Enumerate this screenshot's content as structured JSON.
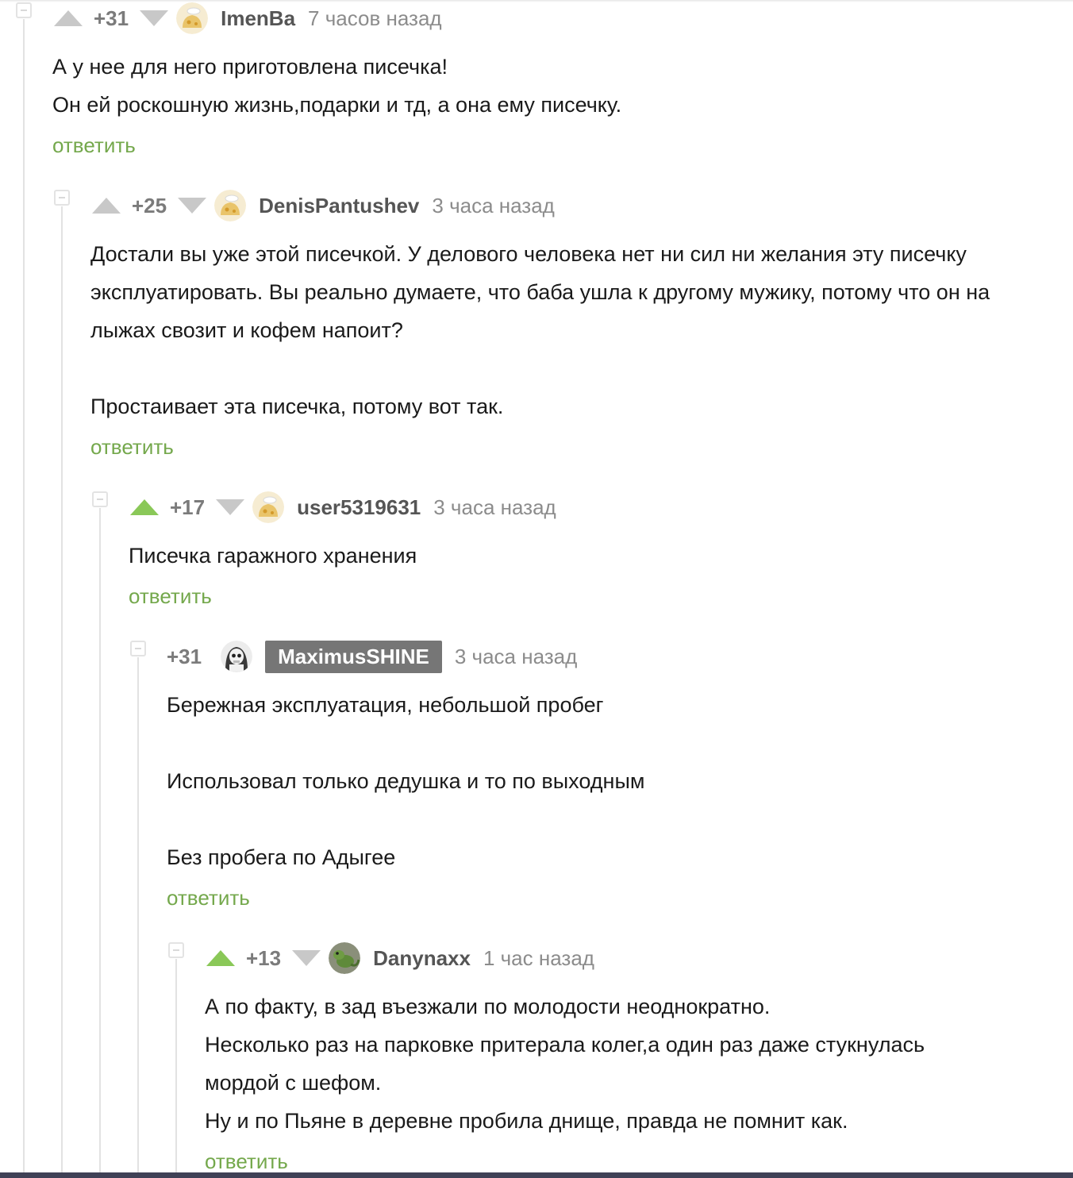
{
  "comments": [
    {
      "score": "+31",
      "author": "ImenBa",
      "time": "7 часов назад",
      "lines": [
        "А у нее для него приготовлена писечка!",
        "Он ей роскошную жизнь,подарки и тд, а она ему писечку."
      ],
      "reply_label": "ответить"
    },
    {
      "score": "+25",
      "author": "DenisPantushev",
      "time": "3 часа назад",
      "lines": [
        "Достали вы уже этой писечкой. У делового человека нет ни сил ни желания эту писечку",
        "эксплуатировать. Вы реально думаете, что баба ушла к другому мужику, потому что он на",
        "лыжах свозит и кофем напоит?",
        "",
        "Простаивает эта писечка, потому вот так."
      ],
      "reply_label": "ответить"
    },
    {
      "score": "+17",
      "author": "user5319631",
      "time": "3 часа назад",
      "upvoted": true,
      "lines": [
        "Писечка гаражного хранения"
      ],
      "reply_label": "ответить"
    },
    {
      "score": "+31",
      "author": "MaximusSHINE",
      "time": "3 часа назад",
      "highlighted_author": true,
      "lines": [
        "Бережная эксплуатация, небольшой пробег",
        "",
        "Использовал только дедушка и то по выходным",
        "",
        "Без пробега по Адыгее"
      ],
      "reply_label": "ответить"
    },
    {
      "score": "+13",
      "author": "Danynaxx",
      "time": "1 час назад",
      "upvoted": true,
      "lines": [
        "А по факту, в зад въезжали по молодости неоднократно.",
        "Несколько раз на парковке притерала колег,а один раз даже стукнулась",
        "мордой с шефом.",
        "Ну и по Пьяне в деревне пробила днище, правда не помнит как."
      ],
      "reply_label": "ответить"
    }
  ],
  "icons": {
    "collapse": "collapse-icon",
    "upvote": "upvote-arrow-icon",
    "downvote": "downvote-arrow-icon",
    "default_avatar": "default-avatar-icon",
    "masked_avatar": "skull-avatar-icon",
    "lizard_avatar": "lizard-avatar-icon"
  },
  "colors": {
    "reply_link": "#74a84c",
    "vote_active": "#8ac858",
    "vote_idle": "#c8c8c8",
    "author_badge_bg": "#767676"
  }
}
